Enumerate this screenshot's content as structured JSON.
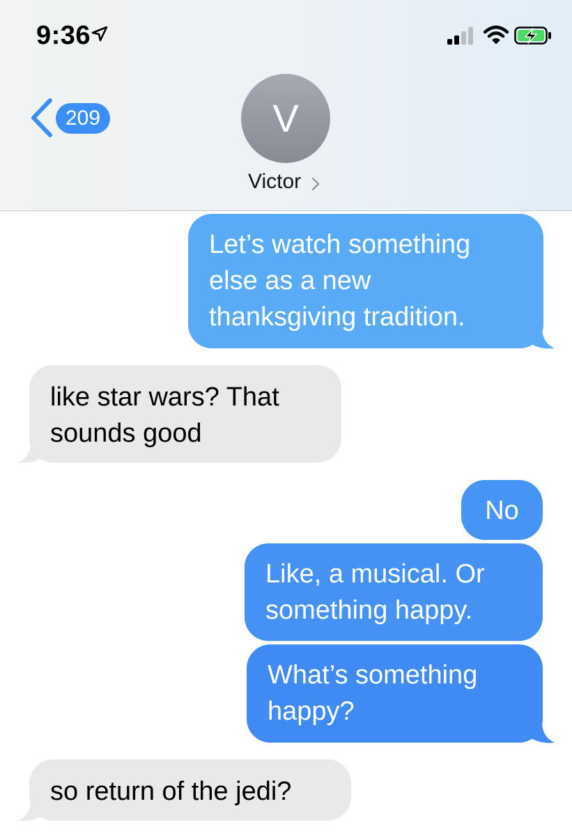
{
  "status_bar": {
    "time": "9:36",
    "location_icon": "location-arrow-icon",
    "signal_icon": "cellular-signal-icon",
    "wifi_icon": "wifi-icon",
    "battery_icon": "battery-charging-icon"
  },
  "nav": {
    "back_icon": "chevron-left-icon",
    "unread_count": "209",
    "contact_initial": "V",
    "contact_name": "Victor",
    "contact_chevron_icon": "chevron-right-icon"
  },
  "colors": {
    "accent": "#3a8ef6",
    "outgoing_bubble": "#4a95f5",
    "incoming_bubble": "#e9e9eb",
    "battery_fill": "#4cd964"
  },
  "messages": [
    {
      "direction": "outgoing",
      "text": "Let’s watch something else as a new thanksgiving tradition."
    },
    {
      "direction": "incoming",
      "text": "like star wars? That sounds good"
    },
    {
      "direction": "outgoing",
      "text": "No"
    },
    {
      "direction": "outgoing",
      "text": "Like, a musical. Or something happy."
    },
    {
      "direction": "outgoing",
      "text": "What’s something happy?"
    },
    {
      "direction": "incoming",
      "text": "so return of the jedi?"
    }
  ]
}
